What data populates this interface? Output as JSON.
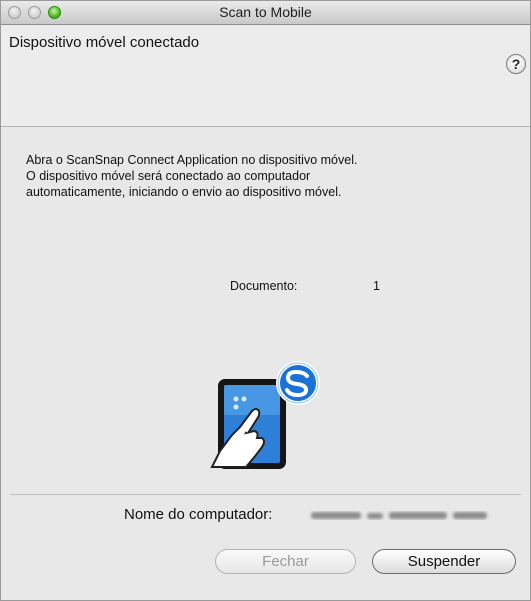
{
  "window": {
    "title": "Scan to Mobile"
  },
  "header": {
    "title": "Dispositivo móvel conectado",
    "help_label": "?"
  },
  "content": {
    "message_line1": "Abra o ScanSnap Connect Application no dispositivo móvel.",
    "message_line2": "O dispositivo móvel será conectado ao computador",
    "message_line3": "automaticamente, iniciando o envio ao dispositivo móvel.",
    "document_label": "Documento:",
    "document_count": "1"
  },
  "footer": {
    "computer_name_label": "Nome do computador:",
    "computer_name_value_blurred": "MacBook de Scanner Silva",
    "close_label": "Fechar",
    "suspend_label": "Suspender"
  },
  "colors": {
    "accent_green": "#3fae17",
    "tablet_blue": "#2e7fd8"
  },
  "icons": {
    "illustration": "tablet-scansnap-icon",
    "help": "help-icon"
  }
}
